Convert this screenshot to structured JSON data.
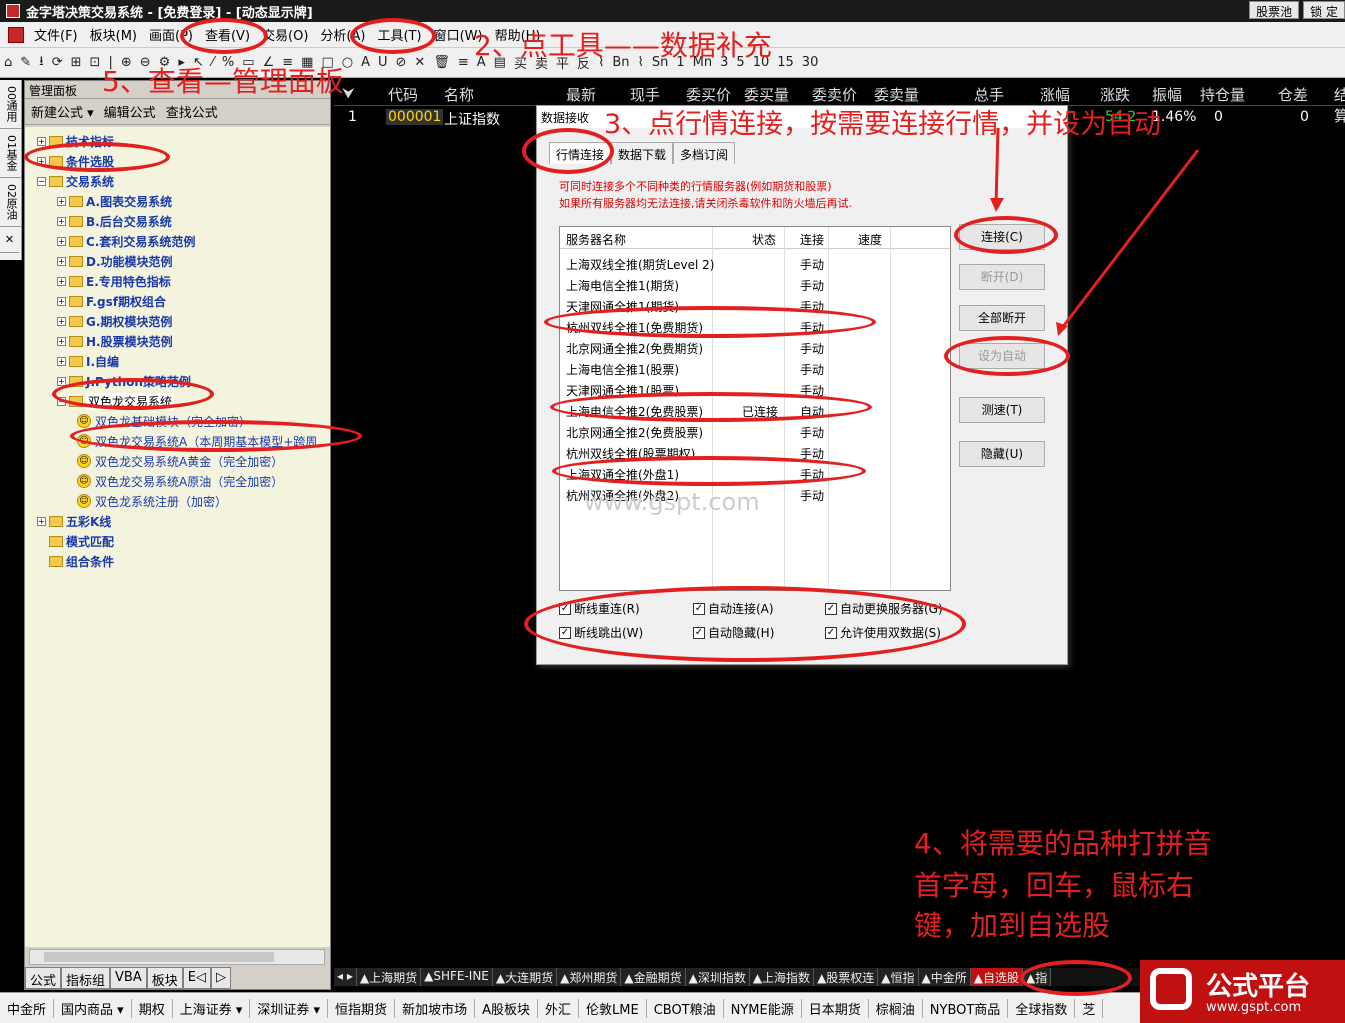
{
  "window": {
    "title": "金字塔决策交易系统 - [免费登录] - [动态显示牌]",
    "btn_pool": "股票池",
    "btn_lock": "锁 定"
  },
  "menu": [
    "文件(F)",
    "板块(M)",
    "画面(P)",
    "查看(V)",
    "交易(O)",
    "分析(A)",
    "工具(T)",
    "窗口(W)",
    "帮助(H)"
  ],
  "toolbar": [
    "⌂",
    "✎",
    "⭳",
    "⟳",
    "⊞",
    "⊡",
    "|",
    "⊕",
    "⊖",
    "⚙",
    "▸",
    "↖",
    "⁄",
    "%",
    "▭",
    "∠",
    "≡",
    "▦",
    "□",
    "○",
    "A",
    "U",
    "⊘",
    "✕",
    "🗑",
    "≡",
    "A",
    "▤",
    "买",
    "卖",
    "平",
    "反",
    "⌇",
    "Bn",
    "⌇",
    "Sn",
    "1",
    "Mn",
    "3",
    "5",
    "10",
    "15",
    "30"
  ],
  "vtabs": [
    "00通用",
    "01基金",
    "02原油"
  ],
  "panel": {
    "title": "管理面板",
    "actions": [
      "新建公式 ▾",
      "编辑公式",
      "查找公式"
    ],
    "tree": [
      {
        "label": "技术指标",
        "level": 0,
        "pm": "+"
      },
      {
        "label": "条件选股",
        "level": 0,
        "pm": "+"
      },
      {
        "label": "交易系统",
        "level": 0,
        "pm": "-"
      },
      {
        "label": "A.图表交易系统",
        "level": 1,
        "pm": "+"
      },
      {
        "label": "B.后台交易系统",
        "level": 1,
        "pm": "+"
      },
      {
        "label": "C.套利交易系统范例",
        "level": 1,
        "pm": "+"
      },
      {
        "label": "D.功能模块范例",
        "level": 1,
        "pm": "+"
      },
      {
        "label": "E.专用特色指标",
        "level": 1,
        "pm": "+"
      },
      {
        "label": "F.gsf期权组合",
        "level": 1,
        "pm": "+"
      },
      {
        "label": "G.期权模块范例",
        "level": 1,
        "pm": "+"
      },
      {
        "label": "H.股票模块范例",
        "level": 1,
        "pm": "+"
      },
      {
        "label": "I.自编",
        "level": 1,
        "pm": "+"
      },
      {
        "label": "J.Python策略范例",
        "level": 1,
        "pm": "+"
      },
      {
        "label": "双色龙交易系统",
        "level": 1,
        "pm": "-",
        "sel": true
      },
      {
        "label": "双色龙基础模块（完全加密）",
        "level": 2,
        "smile": true
      },
      {
        "label": "双色龙交易系统A（本周期基本模型+跨周",
        "level": 2,
        "smile": true
      },
      {
        "label": "双色龙交易系统A黄金（完全加密）",
        "level": 2,
        "smile": true
      },
      {
        "label": "双色龙交易系统A原油（完全加密）",
        "level": 2,
        "smile": true
      },
      {
        "label": "双色龙系统注册（加密）",
        "level": 2,
        "smile": true
      },
      {
        "label": "五彩K线",
        "level": 0,
        "pm": "+"
      },
      {
        "label": "模式匹配",
        "level": 0,
        "pm": ""
      },
      {
        "label": "组合条件",
        "level": 0,
        "pm": ""
      }
    ],
    "bottom_tabs": [
      "公式",
      "指标组",
      "VBA",
      "板块",
      "E◁",
      "▷"
    ]
  },
  "quote": {
    "headers": [
      "代码",
      "名称",
      "最新",
      "现手",
      "委买价",
      "委买量",
      "委卖价",
      "委卖量",
      "总手",
      "涨幅",
      "涨跌",
      "振幅",
      "持仓量",
      "仓差",
      "结算"
    ],
    "row": {
      "idx": "1",
      "code": "000001",
      "name": "上证指数",
      "chg": "-54.2",
      "amp": "1.46%",
      "v1": "0",
      "v2": "0"
    }
  },
  "dialog": {
    "title": "数据接收",
    "tabs": [
      "行情连接",
      "数据下载",
      "多档订阅"
    ],
    "note1": "可同时连接多个不同种类的行情服务器(例如期货和股票)",
    "note2": "如果所有服务器均无法连接,请关闭杀毒软件和防火墙后再试.",
    "cols": [
      "服务器名称",
      "状态",
      "连接",
      "速度"
    ],
    "servers": [
      {
        "name": "上海双线全推(期货Level 2)",
        "status": "",
        "conn": "手动"
      },
      {
        "name": "上海电信全推1(期货)",
        "status": "",
        "conn": "手动"
      },
      {
        "name": "天津网通全推1(期货)",
        "status": "",
        "conn": "手动"
      },
      {
        "name": "杭州双线全推1(免费期货)",
        "status": "",
        "conn": "手动"
      },
      {
        "name": "北京网通全推2(免费期货)",
        "status": "",
        "conn": "手动"
      },
      {
        "name": "上海电信全推1(股票)",
        "status": "",
        "conn": "手动"
      },
      {
        "name": "天津网通全推1(股票)",
        "status": "",
        "conn": "手动"
      },
      {
        "name": "上海电信全推2(免费股票)",
        "status": "已连接",
        "conn": "自动"
      },
      {
        "name": "北京网通全推2(免费股票)",
        "status": "",
        "conn": "手动"
      },
      {
        "name": "杭州双线全推(股票期权)",
        "status": "",
        "conn": "手动"
      },
      {
        "name": "上海双通全推(外盘1)",
        "status": "",
        "conn": "手动"
      },
      {
        "name": "杭州双通全推(外盘2)",
        "status": "",
        "conn": "手动"
      }
    ],
    "buttons": {
      "connect": "连接(C)",
      "disconnect": "断开(D)",
      "disconnect_all": "全部断开",
      "set_auto": "设为自动",
      "speed": "测速(T)",
      "hide": "隐藏(U)"
    },
    "checks": [
      "断线重连(R)",
      "自动连接(A)",
      "自动更换服务器(G)",
      "断线跳出(W)",
      "自动隐藏(H)",
      "允许使用双数据(S)"
    ]
  },
  "market_tabs": [
    "◂ ▸",
    "▲上海期货",
    "▲SHFE-INE",
    "▲大连期货",
    "▲郑州期货",
    "▲金融期货",
    "▲深圳指数",
    "▲上海指数",
    "▲股票权连",
    "▲恒指",
    "▲中金所",
    "▲自选股",
    "▲指"
  ],
  "bottombar": [
    "中金所",
    "国内商品 ▾",
    "期权",
    "上海证券 ▾",
    "深圳证券 ▾",
    "恒指期货",
    "新加坡市场",
    "A股板块",
    "外汇",
    "伦敦LME",
    "CBOT粮油",
    "NYME能源",
    "日本期货",
    "棕榈油",
    "NYBOT商品",
    "全球指数",
    "芝"
  ],
  "annotations": {
    "a2": "2、点工具——数据补充",
    "a3": "3、点行情连接，按需要连接行情，并设为自动",
    "a4_1": "4、将需要的品种打拼音",
    "a4_2": "首字母，回车，鼠标右",
    "a4_3": "键，加到自选股",
    "a5": "5、查看—管理面板"
  },
  "watermark": "www.gspt.com",
  "logo": {
    "t1": "公式平台",
    "t2": "www.gspt.com"
  }
}
